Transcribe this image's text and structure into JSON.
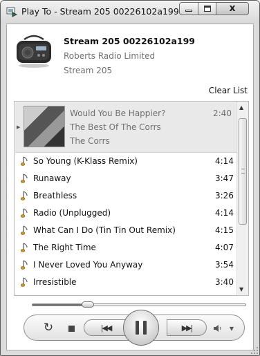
{
  "window": {
    "title": "Play To - Stream 205 00226102a199",
    "close_glyph": "x"
  },
  "device": {
    "name": "Stream 205 00226102a199",
    "manufacturer": "Roberts Radio Limited",
    "model": "Stream 205",
    "icon": "radio-icon"
  },
  "actions": {
    "clear_list": "Clear List"
  },
  "now_playing": {
    "title": "Would You Be Happier?",
    "album": "The Best Of The Corrs",
    "artist": "The Corrs",
    "duration": "2:40"
  },
  "playlist": [
    {
      "title": "So Young (K-Klass Remix)",
      "duration": "4:14"
    },
    {
      "title": "Runaway",
      "duration": "3:47"
    },
    {
      "title": "Breathless",
      "duration": "3:26"
    },
    {
      "title": "Radio (Unplugged)",
      "duration": "4:14"
    },
    {
      "title": "What Can I Do (Tin Tin Out Remix)",
      "duration": "4:15"
    },
    {
      "title": "The Right Time",
      "duration": "4:07"
    },
    {
      "title": "I Never Loved You Anyway",
      "duration": "3:54"
    },
    {
      "title": "Irresistible",
      "duration": "3:40"
    }
  ],
  "playback": {
    "progress_fraction": 0.26,
    "state": "playing"
  },
  "colors": {
    "now_playing_background": "#e9e9e9",
    "secondary_text": "#707070"
  }
}
